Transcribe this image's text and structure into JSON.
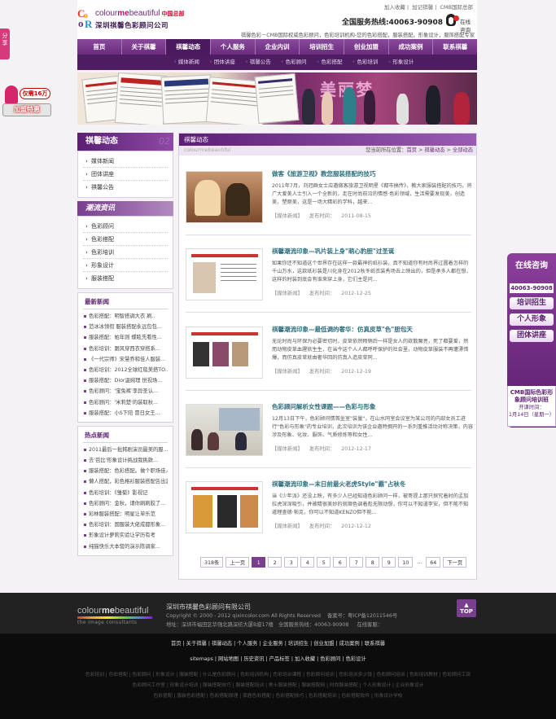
{
  "top": {
    "links": [
      "加入收藏",
      "加记祺馨",
      "CMB国际总部"
    ],
    "brand_main": "colour",
    "brand_me": "me",
    "brand_tail": "beautiful",
    "brand_hq": "中国总部",
    "company": "深圳祺馨色彩顾问公司",
    "hotline_label": "全国服务热线:",
    "hotline": "40063-90908",
    "qq_label": "在线咨询",
    "slogan": "祺馨色彩－CMB国际权威色彩顾问，色彩培训机构-您的色彩搭配，服装搭配，形象设计，服饰搭配专家"
  },
  "nav": {
    "items": [
      "首页",
      "关于祺馨",
      "祺馨动态",
      "个人服务",
      "企业内训",
      "培训招生",
      "创业加盟",
      "成功案例",
      "联系祺馨"
    ],
    "active": 2
  },
  "subnav": [
    "媒体新闻",
    "团体讲座",
    "祺馨公告",
    "色彩顾问",
    "色彩搭配",
    "色彩培训",
    "形象设计"
  ],
  "banner": {
    "text": "美丽梦"
  },
  "left": {
    "title": "祺馨动态",
    "title_wm": "02",
    "menu": [
      "媒体新闻",
      "团体讲座",
      "祺馨公告"
    ],
    "trend_title": "潮流资讯",
    "trend": [
      "色彩顾问",
      "色彩搭配",
      "色彩培训",
      "形象设计",
      "服装搭配"
    ],
    "latest_title": "最新新闻",
    "latest": [
      "色彩搭配：明智搭调大衣 刷..",
      "范冰冰领衔 服装搭配永远包包...",
      "服装搭配：帕年则 蝶眩先看性...",
      "色彩培训：跟风穿西衣穿搭系...",
      "《一代宗师》宋慧乔和佳人服装...",
      "色彩培训：2012全球红毯美搭TO...",
      "服装搭配：Dior温婉理 悦视场...",
      "色彩顾问：'宝兔裤'李异圣认...",
      "色彩顾问：'米莉楚'的装取秋...",
      "服装搭配：小S下陪 冒日女王..."
    ],
    "hot_title": "热点新闻",
    "hot": [
      "2011最后一批韩剧演员最美的服...",
      "去'芭比'形象设计挑战我挑款...",
      "服装搭配：色彩搭配。做个职场佳人",
      "懒人搭配，彩色格衫服装搭配告出游",
      "色彩培训：《雏菊》影视记",
      "色彩顾问：金秋，请你刷刷胶了...",
      "彩林服装搭配：明星让单乐范",
      "色彩培训：国服装大佬成都形象...",
      "形象设计萝莉实验让学历有考",
      "纯猫快乐大本营的演示陈调家..."
    ]
  },
  "main": {
    "title": "祺馨动态",
    "watermark": "colourmebeautiful",
    "crumb_label": "您当前所在位置：",
    "crumb": [
      "首页",
      "祺馨动态",
      "全部动态"
    ],
    "articles": [
      {
        "title": "做客《旅游卫视》教您服装搭配的技巧",
        "desc": "2011年7月，刘冠群女士应邀做客旅游卫视明星《都市搞传》，教大家服装搭配的技巧，将广大爱美人士引入一个全新的，走在时尚前沿的情感·色彩领域，生活需要发现美，创造美，塑原美，这是一场大精彩的学科，越来...",
        "tag": "【媒体新闻】",
        "date_label": "发布时间：",
        "date": "2011-08-15"
      },
      {
        "title": "祺馨潮流印象—巩片装上身\"萌心豹胆\"过圣诞",
        "desc": "如果你还不知道这个世界存在这样一款最神的纸衫装，真不知道你有时尚界过圆着怎样的千山万水，这款纸衫装是川化身在2012秋冬纸衣装秀场去上映出的，但是承多人都在想，这样的时装到底会有谁来穿上身，它们主是问...",
        "tag": "【媒体新闻】",
        "date_label": "发布时间：",
        "date": "2012-12-25"
      },
      {
        "title": "祺馨潮流印象—最低调的奢华：仿真皮草\"色\"胆包天",
        "desc": "无论时尚与环保为必要密切时，皮草依然畅销后一样是女人的欲散魔亮，死了都要爱，然而动物皮草血腥依生生，在当今这个人人都呼呼保护的社会里，动物皮草服装不再遭漂惜爆，而仿真皮草就由奢华回的仿真人造皮草同...",
        "tag": "【媒体新闻】",
        "date_label": "发布时间：",
        "date": "2012-12-19"
      },
      {
        "title": "色彩顾问解析女性课题——色彩与形象",
        "desc": "12月13日下午，色彩顾问情首坐室\"装量\"，在山水同室会议室为某公司的内部女员工进行\"色彩与形象\"的专业培训，此次培训为该企业邀特拥开的一系列重推活动对称决策，内容涉及形象、化妆、服饰、气质修炼等和女性...",
        "tag": "【媒体新闻】",
        "date_label": "发布时间：",
        "date": "2012-12-17"
      },
      {
        "title": "祺馨潮流印象—末日前最火老虎Style\"霸\"占秋冬",
        "desc": "当《少年派》还没上映，有多少人已经知道色彩顾问一样，被哥提上那只探究着时的孟加拉虎深深吸引，并被精很美妙的就顺色调着彪无限动想，你可以不知道李安，但不能不知道理查德·帕克，你可以不知道KENZO但不能...",
        "tag": "【媒体新闻】",
        "date_label": "发布时间：",
        "date": "2012-12-12"
      }
    ],
    "pager": {
      "total": "318条",
      "prev": "上一页",
      "pages": [
        "1",
        "2",
        "3",
        "4",
        "5",
        "6",
        "7",
        "8",
        "9",
        "10"
      ],
      "ellipsis": "...",
      "last": "64",
      "next": "下一页"
    }
  },
  "footer": {
    "logo_a": "colour",
    "logo_me": "me",
    "logo_b": "beautiful",
    "logo_sub": "the image consultants",
    "company": "深圳市祺馨色彩顾问有限公司",
    "copyright": "Copyright © 2000 - 2012 qixincolor.com All Rights Reserved",
    "icp": "备案号：粤ICP备12011546号",
    "address": "地址：深圳市福田区华强北路深纺大厦B座17楼",
    "hotline": "全国服务热线：40063-90908",
    "online": "在线客服：",
    "top": "TOP",
    "nav1": "首页 | 关于祺馨 | 祺馨动态 | 个人服务 | 企业服务 | 培训招生 | 创业加盟 | 成功案例 | 联系祺馨",
    "nav2": "sitemaps | 网站地图 | 历史资讯 | 产品标签 | 加入收藏 | 色彩顾问 | 色彩设计",
    "links1": "色彩培训 | 色彩搭配 | 色彩顾问 | 形象设计 | 服装搭配 | 什么是色彩顾问 | 色彩培训机构 | 色彩培训课程 | 色彩顾问培训 | 色彩培训多少钱 | 色彩顾问培训 | 色彩培训教材 | 色彩顾问工资",
    "links2": "色彩顾问工作室 | 形象设计培训 | 服装搭配技巧 | 服装搭配培训 | 男士服装搭配 | 服装搭配网 | 时尚服装搭配 | 个人形象设计 | 企业形象设计",
    "links3": "色彩搭配 | 服装色彩搭配 | 色彩搭配原理 | 家居色彩搭配 | 色彩搭配技巧 | 色彩搭配培训 | 色彩搭配软件 | 形象设计学校"
  },
  "floats": {
    "share": "分享",
    "jiamo_bubble": "仅需16万",
    "jiamo_bar": "加盟特惠",
    "online_title": "在线咨询",
    "online_tel": "40063-90908",
    "online_btns": [
      "培训招生",
      "个人形象",
      "团体讲座"
    ],
    "promo": "CMB国际色彩形象顾问培训班",
    "promo_label": "开课时间：",
    "promo_date": "1月14日（星期一）"
  },
  "colors": {
    "brand_purple": "#6a2b79",
    "nav_active": "#4b1a5e",
    "link_teal": "#2d6f7e"
  }
}
